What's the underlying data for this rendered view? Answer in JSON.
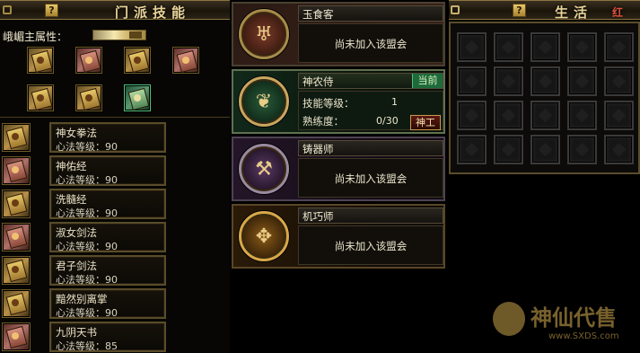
{
  "left_panel": {
    "title": "门派技能",
    "help_icon": "?",
    "attribute_label": "峨嵋主属性：",
    "skills": [
      {
        "name": "神女拳法",
        "level": "心法等级：90"
      },
      {
        "name": "神佑经",
        "level": "心法等级：90"
      },
      {
        "name": "洗髓经",
        "level": "心法等级：90"
      },
      {
        "name": "淑女剑法",
        "level": "心法等级：90"
      },
      {
        "name": "君子剑法",
        "level": "心法等级：90"
      },
      {
        "name": "黯然别离掌",
        "level": "心法等级：90"
      },
      {
        "name": "九阴天书",
        "level": "心法等级：85"
      }
    ]
  },
  "mid_panel": {
    "cards": [
      {
        "name": "玉食客",
        "status": "尚未加入该盟会",
        "emblem_icon": "fish-dragon-icon"
      },
      {
        "name": "神农侍",
        "current_badge": "当前",
        "skill_level_label": "技能等级：",
        "skill_level_value": "1",
        "proficiency_label": "熟练度：",
        "proficiency_value": "0/30",
        "craft_button": "神工",
        "emblem_icon": "leaf-circle-icon"
      },
      {
        "name": "铸器师",
        "status": "尚未加入该盟会",
        "emblem_icon": "anvil-blades-icon"
      },
      {
        "name": "机巧师",
        "status": "尚未加入该盟会",
        "emblem_icon": "gear-device-icon"
      }
    ]
  },
  "right_panel": {
    "title": "生活",
    "title_tail": "红",
    "help_icon": "?"
  },
  "watermark": {
    "brand": "神仙代售",
    "url": "www.SXDS.com"
  },
  "colors": {
    "gold_border": "#a58a45",
    "current_badge": "#1e6a3a",
    "title_text": "#e8d49a"
  }
}
